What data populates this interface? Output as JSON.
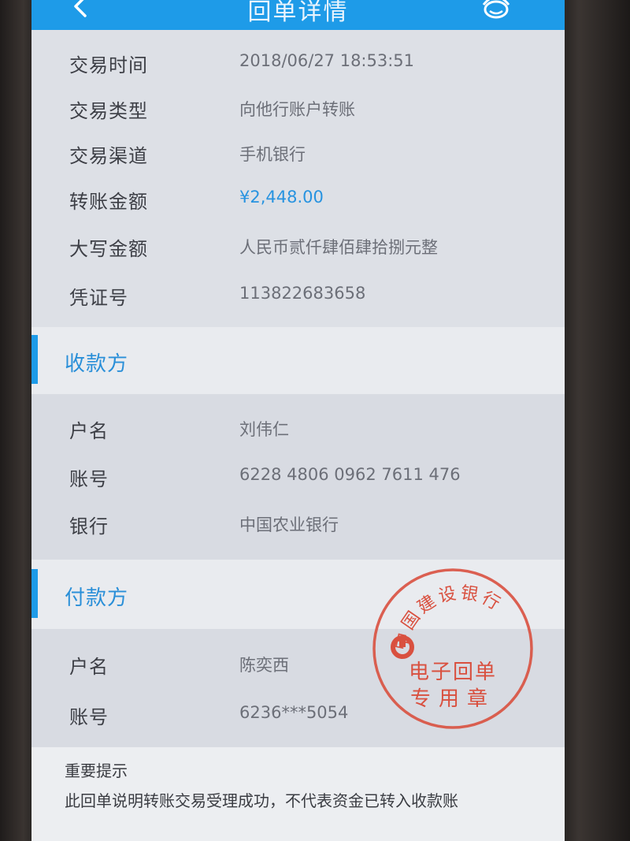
{
  "header": {
    "title": "回单详情",
    "back_icon": "back-arrow-icon",
    "service_icon": "customer-service-icon"
  },
  "transaction": {
    "time_label": "交易时间",
    "time_value": "2018/06/27  18:53:51",
    "type_label": "交易类型",
    "type_value": "向他行账户转账",
    "channel_label": "交易渠道",
    "channel_value": "手机银行",
    "amount_label": "转账金额",
    "amount_value": "¥2,448.00",
    "amount_words_label": "大写金额",
    "amount_words_value": "人民币贰仟肆佰肆拾捌元整",
    "voucher_label": "凭证号",
    "voucher_value": "113822683658"
  },
  "payee": {
    "section_title": "收款方",
    "name_label": "户名",
    "name_value": "刘伟仁",
    "account_label": "账号",
    "account_value": "6228 4806 0962 7611 476",
    "bank_label": "银行",
    "bank_value": "中国农业银行"
  },
  "payer": {
    "section_title": "付款方",
    "name_label": "户名",
    "name_value": "陈奕西",
    "account_label": "账号",
    "account_value": "6236***5054"
  },
  "stamp": {
    "ring_text": "中国建设银行",
    "line1": "电子回单",
    "line2": "专用章"
  },
  "notice": {
    "title": "重要提示",
    "body": "此回单说明转账交易受理成功，不代表资金已转入收款账"
  },
  "colors": {
    "accent": "#1e9be8",
    "amount": "#2793e0",
    "stamp_red": "#d9503f"
  }
}
